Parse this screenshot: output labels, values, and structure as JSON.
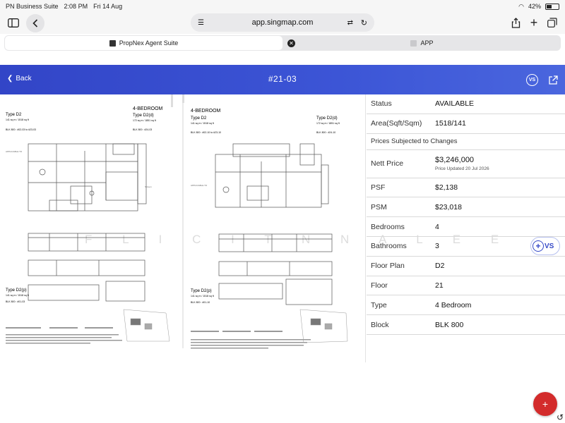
{
  "status_bar": {
    "carrier": "PN Business Suite",
    "time": "2:08 PM",
    "date": "Fri 14 Aug",
    "battery": "42%",
    "battery_level": 0.42
  },
  "browser": {
    "url": "app.singmap.com",
    "tabs": [
      {
        "label": "PropNex Agent Suite"
      },
      {
        "label": "APP"
      }
    ]
  },
  "header": {
    "back_label": "Back",
    "title": "#21-03",
    "vs_label": "VS"
  },
  "plan": {
    "left": {
      "type": "Type D2",
      "area": "141 sq m / 1518 sq ft",
      "blk": "BLK 800 : #02-03 to #23-03",
      "heading": "4-BEDROOM",
      "alt_type": "Type D2(d)",
      "alt_area": "172 sq m / 1851 sq ft",
      "alt_blk": "BLK 800 : #24-03",
      "penthouse_type": "Type D2(p)",
      "penthouse_area": "141 sq m / 1518 sq ft",
      "penthouse_blk": "BLK 800 : #01-03"
    },
    "right": {
      "heading": "4-BEDROOM",
      "type": "Type D2",
      "area": "141 sq m / 1518 sq ft",
      "blk": "BLK 800 : #02-10 to #23-10",
      "alt_type": "Type D2(d)",
      "alt_area": "172 sq m / 1851 sq ft",
      "alt_blk": "BLK 800 : #24-10",
      "penthouse_type": "Type D2(p)",
      "penthouse_area": "141 sq m / 1518 sq ft",
      "penthouse_blk": "BLK 800 : #01-10"
    },
    "watermark": "F L I C I T   N N A L E E"
  },
  "details": {
    "status": {
      "label": "Status",
      "value": "AVAILABLE"
    },
    "area": {
      "label": "Area(Sqft/Sqm)",
      "value": "1518/141"
    },
    "note": "Prices Subjected to Changes",
    "nett_price": {
      "label": "Nett Price",
      "value": "$3,246,000",
      "updated": "Price Updated 20 Jul 2026"
    },
    "psf": {
      "label": "PSF",
      "value": "$2,138"
    },
    "psm": {
      "label": "PSM",
      "value": "$23,018"
    },
    "bedrooms": {
      "label": "Bedrooms",
      "value": "4"
    },
    "bathrooms": {
      "label": "Bathrooms",
      "value": "3"
    },
    "floor_plan": {
      "label": "Floor Plan",
      "value": "D2"
    },
    "floor": {
      "label": "Floor",
      "value": "21"
    },
    "type": {
      "label": "Type",
      "value": "4 Bedroom"
    },
    "block": {
      "label": "Block",
      "value": "BLK 800"
    }
  },
  "floating": {
    "vs_label": "VS",
    "fab_icon": "plus-icon"
  }
}
